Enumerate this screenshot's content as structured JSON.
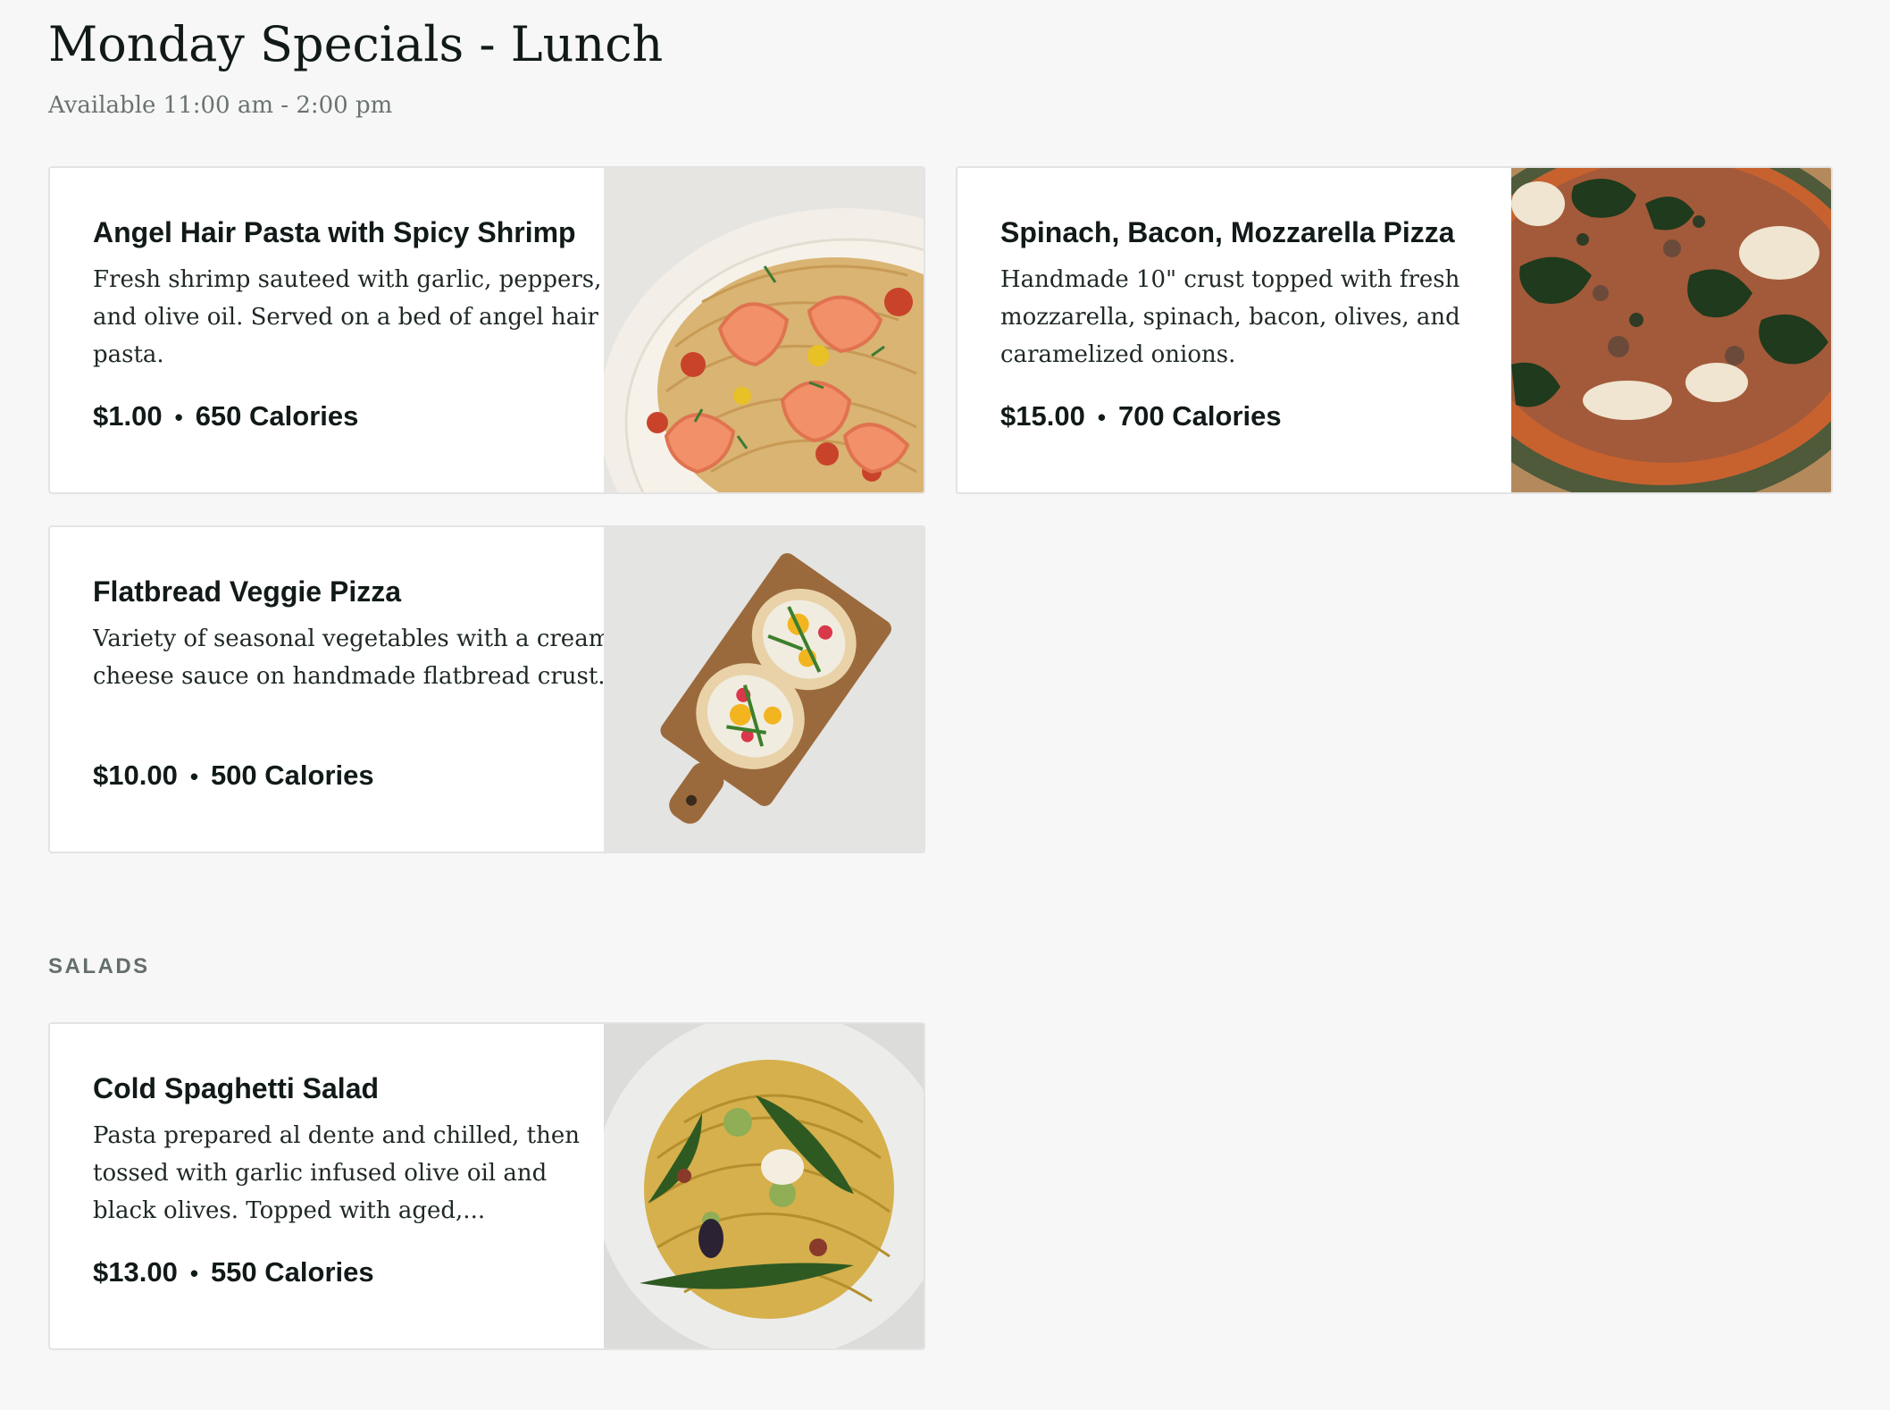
{
  "menu": {
    "title": "Monday Specials - Lunch",
    "availability": "Available 11:00 am - 2:00 pm"
  },
  "items": [
    {
      "name": "Angel Hair Pasta with Spicy Shrimp",
      "description": "Fresh shrimp sauteed with garlic, peppers, and olive oil. Served on a bed of angel hair pasta.",
      "price": "$1.00",
      "separator": "•",
      "calories": "650 Calories",
      "image": "shrimp-pasta-photo"
    },
    {
      "name": "Spinach, Bacon, Mozzarella Pizza",
      "description": "Handmade 10\" crust topped with fresh mozzarella, spinach, bacon, olives, and caramelized onions.",
      "price": "$15.00",
      "separator": "•",
      "calories": "700 Calories",
      "image": "spinach-pizza-photo"
    },
    {
      "name": "Flatbread Veggie Pizza",
      "description": "Variety of seasonal vegetables with a cream cheese sauce on handmade flatbread crust.",
      "price": "$10.00",
      "separator": "•",
      "calories": "500 Calories",
      "image": "flatbread-photo"
    }
  ],
  "sections": [
    {
      "label": "SALADS",
      "items": [
        {
          "name": "Cold Spaghetti Salad",
          "description": "Pasta prepared al dente and chilled, then tossed with garlic infused olive oil and black olives. Topped with aged,...",
          "price": "$13.00",
          "separator": "•",
          "calories": "550 Calories",
          "image": "spaghetti-salad-photo"
        }
      ]
    }
  ],
  "colors": {
    "background": "#f7f7f7",
    "card": "#ffffff",
    "text": "#111a19",
    "muted": "#6b7372"
  }
}
